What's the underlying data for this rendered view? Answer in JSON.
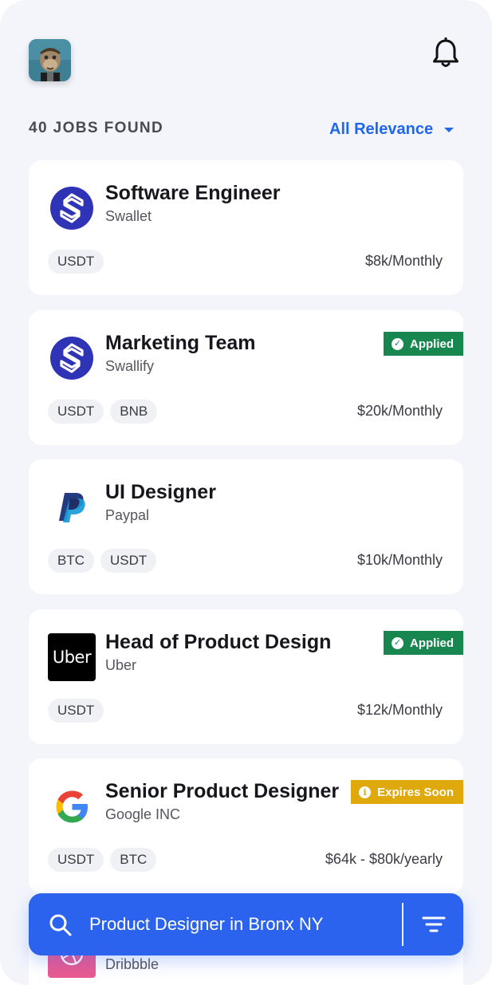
{
  "header": {
    "avatar_icon": "ape-avatar",
    "notification_icon": "bell-icon"
  },
  "results": {
    "count_label": "40 JOBS FOUND",
    "sort_label": "All Relevance"
  },
  "jobs": [
    {
      "title": "Software Engineer",
      "company": "Swallet",
      "logo_icon": "swallet-logo",
      "tags": [
        "USDT"
      ],
      "salary": "$8k/Monthly",
      "badge": null
    },
    {
      "title": "Marketing Team",
      "company": "Swallify",
      "logo_icon": "swallify-logo",
      "tags": [
        "USDT",
        "BNB"
      ],
      "salary": "$20k/Monthly",
      "badge": "Applied"
    },
    {
      "title": "UI Designer",
      "company": "Paypal",
      "logo_icon": "paypal-logo",
      "tags": [
        "BTC",
        "USDT"
      ],
      "salary": "$10k/Monthly",
      "badge": null
    },
    {
      "title": "Head of Product Design",
      "company": "Uber",
      "logo_icon": "uber-logo",
      "logo_text": "Uber",
      "tags": [
        "USDT"
      ],
      "salary": "$12k/Monthly",
      "badge": "Applied"
    },
    {
      "title": "Senior Product Designer",
      "company": "Google INC",
      "logo_icon": "google-logo",
      "tags": [
        "USDT",
        "BTC"
      ],
      "salary": "$64k - $80k/yearly",
      "badge": "Expires Soon"
    },
    {
      "company": "Dribbble",
      "logo_icon": "dribbble-logo"
    }
  ],
  "search": {
    "query": "Product Designer in Bronx NY",
    "search_icon": "search-icon",
    "filter_icon": "filter-icon"
  },
  "colors": {
    "accent": "#2b63ef",
    "applied": "#17874f",
    "expires": "#dfa90b",
    "background": "#f3f5fb"
  }
}
